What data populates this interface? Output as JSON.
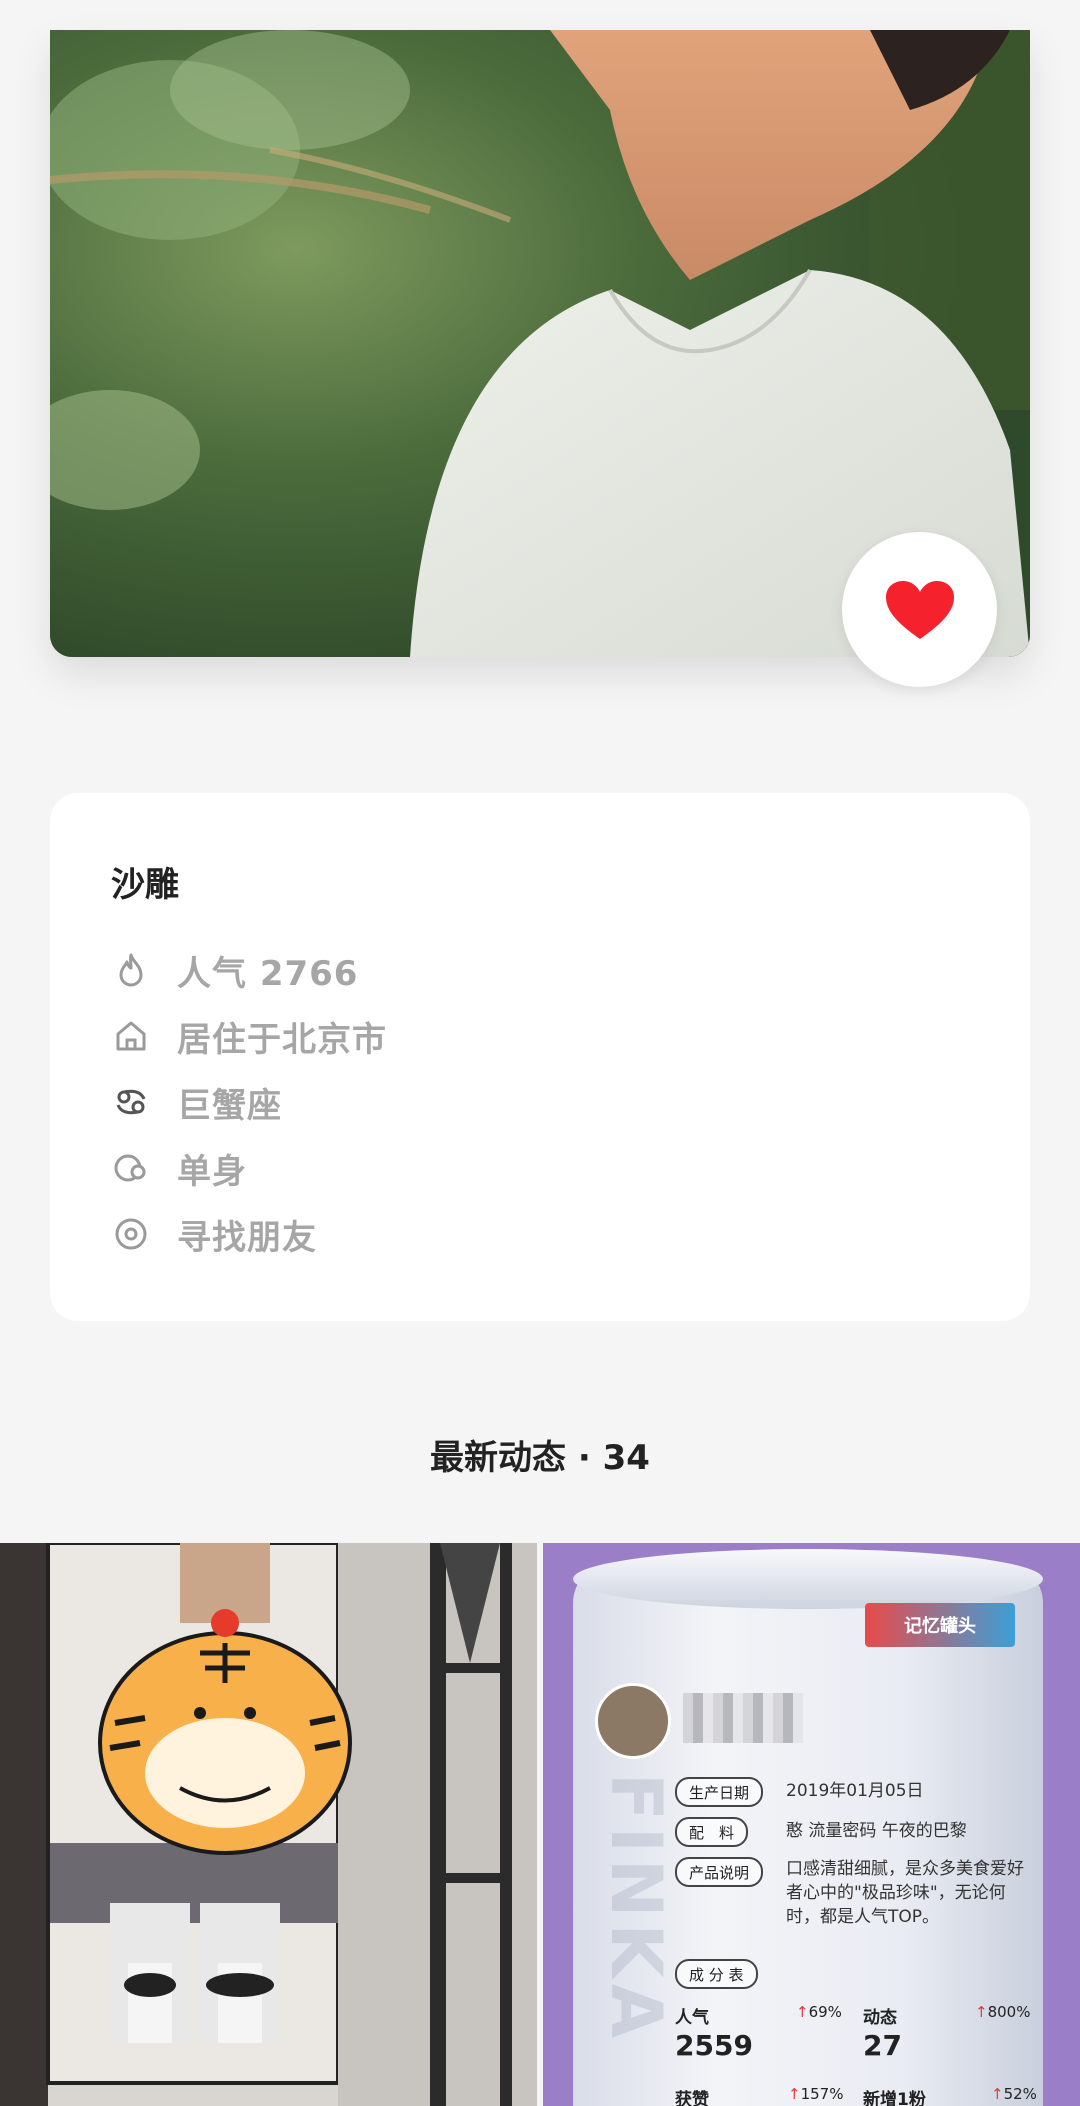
{
  "profile": {
    "name": "沙雕",
    "info": [
      {
        "icon": "flame-icon",
        "text": "人气 2766"
      },
      {
        "icon": "home-icon",
        "text": "居住于北京市"
      },
      {
        "icon": "zodiac-icon",
        "text": "巨蟹座"
      },
      {
        "icon": "heart-status-icon",
        "text": "单身"
      },
      {
        "icon": "target-icon",
        "text": "寻找朋友"
      }
    ]
  },
  "feed": {
    "title": "最新动态 · 34"
  },
  "card": {
    "brand": "记忆罐头",
    "watermark": "FINKA",
    "labels": {
      "birth": "生产日期",
      "ingredients": "配　料",
      "desc": "产品说明",
      "components": "成 分 表"
    },
    "birth_value": "2019年01月05日",
    "ingredients_value": "憨 流量密码 午夜的巴黎",
    "desc_value": "口感清甜细腻，是众多美食爱好者心中的\"极品珍味\"，无论何时，都是人气TOP。",
    "stats": [
      {
        "label": "人气",
        "change": "69%",
        "value": "2559"
      },
      {
        "label": "动态",
        "change": "800%",
        "value": "27"
      }
    ],
    "bottom": [
      {
        "label": "获赞",
        "change": "157%"
      },
      {
        "label": "新增1粉",
        "change": "52%"
      }
    ]
  },
  "colors": {
    "like_heart": "#f5222d",
    "accent_up": "#e23b3b"
  }
}
